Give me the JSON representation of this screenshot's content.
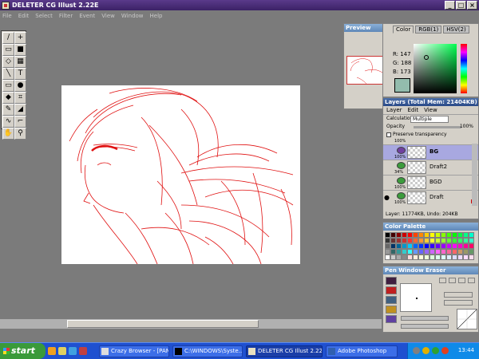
{
  "window": {
    "title": "DELETER CG Illust 2.22E"
  },
  "menu": [
    "File",
    "Edit",
    "Select",
    "Filter",
    "Event",
    "View",
    "Window",
    "Help"
  ],
  "tools": [
    "pen-icon",
    "move-icon",
    "eraser-icon",
    "fill-black-icon",
    "lasso-icon",
    "grid-icon",
    "line-icon",
    "text-icon",
    "rect-icon",
    "blob-icon",
    "shape-icon",
    "crop-icon",
    "brush-icon",
    "dropper-icon",
    "curve-icon",
    "picker-icon",
    "hand-icon",
    "zoom-icon"
  ],
  "preview": {
    "title": "Preview"
  },
  "color": {
    "tabs": [
      "Color",
      "RGB(1)",
      "HSV(2)"
    ],
    "r_label": "R: 147",
    "g_label": "G: 188",
    "b_label": "B: 173",
    "current": "#93bcad"
  },
  "layers": {
    "title": "Layers (Total Mem: 21404KB)",
    "menu": [
      "Layer",
      "Edit",
      "View"
    ],
    "calculation_label": "Calculation",
    "calculation_value": "Multiple",
    "opacity_label": "Opacity",
    "opacity_value": "100%",
    "preserve_label": "Preserve transparency",
    "top_pct": "100%",
    "items": [
      {
        "name": "BG",
        "pct": "100%",
        "selected": true
      },
      {
        "name": "Draft2",
        "pct": "34%",
        "selected": false
      },
      {
        "name": "BGD",
        "pct": "100%",
        "selected": false
      },
      {
        "name": "Draft",
        "pct": "100%",
        "selected": false
      }
    ],
    "status": "Layer: 11774KB, Undo: 204KB"
  },
  "palette": {
    "title": "Color Palette"
  },
  "pen": {
    "title": "Pen Window Eraser"
  },
  "taskbar": {
    "start": "start",
    "items": [
      "Crazy Browser - [PAN...",
      "C:\\WINDOWS\\Syste...",
      "DELETER CG Illust 2.22E",
      "Adobe Photoshop"
    ],
    "clock": "13:44"
  }
}
